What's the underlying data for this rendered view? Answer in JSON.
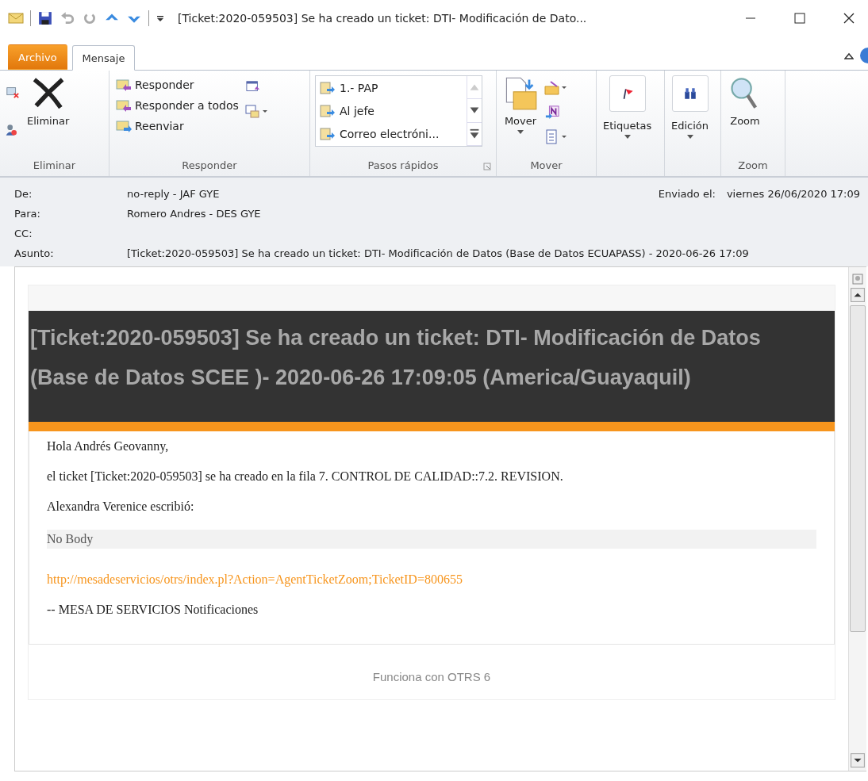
{
  "window": {
    "title": "[Ticket:2020-059503] Se ha creado un ticket: DTI- Modificación de Dato..."
  },
  "ribbon_tabs": [
    {
      "label": "Archivo",
      "kind": "file",
      "selected": false
    },
    {
      "label": "Mensaje",
      "kind": "tab",
      "selected": true
    }
  ],
  "ribbon": {
    "eliminar": {
      "group": "Eliminar",
      "delete": "Eliminar"
    },
    "responder": {
      "group": "Responder",
      "items": [
        "Responder",
        "Responder a todos",
        "Reenviar"
      ]
    },
    "quick_steps": {
      "group": "Pasos rápidos",
      "items": [
        "1.- PAP",
        "Al jefe",
        "Correo electróni..."
      ]
    },
    "mover": {
      "group": "Mover",
      "move": "Mover"
    },
    "etiquetas": {
      "label": "Etiquetas"
    },
    "edicion": {
      "label": "Edición"
    },
    "zoom": {
      "group": "Zoom",
      "zoom": "Zoom"
    }
  },
  "header": {
    "fields": [
      {
        "label": "De:",
        "value": "no-reply - JAF GYE"
      },
      {
        "label": "Para:",
        "value": "Romero Andres - DES GYE"
      },
      {
        "label": "CC:"
      },
      {
        "label": "Asunto:",
        "value": "[Ticket:2020-059503] Se ha creado un ticket: DTI- Modificación de Datos (Base de Datos ECUAPASS) - 2020-06-26 17:09"
      }
    ],
    "sent_label": "Enviado el:",
    "sent_value": "viernes 26/06/2020 17:09"
  },
  "email": {
    "banner": "[Ticket:2020-059503] Se ha creado un ticket: DTI- Modificación de Datos (Base de Datos SCEE )- 2020-06-26 17:09:05 (America/Guayaquil)",
    "greeting": "Hola Andrés Geovanny,",
    "line": "el ticket [Ticket:2020-059503] se ha creado en la fila 7. CONTROL DE CALIDAD::7.2. REVISION.",
    "wrote": "Alexandra Verenice escribió:",
    "quote": "No Body",
    "link": "http://mesadeservicios/otrs/index.pl?Action=AgentTicketZoom;TicketID=800655",
    "signature": "-- MESA DE SERVICIOS Notificaciones",
    "footer": "Funciona con OTRS 6"
  }
}
